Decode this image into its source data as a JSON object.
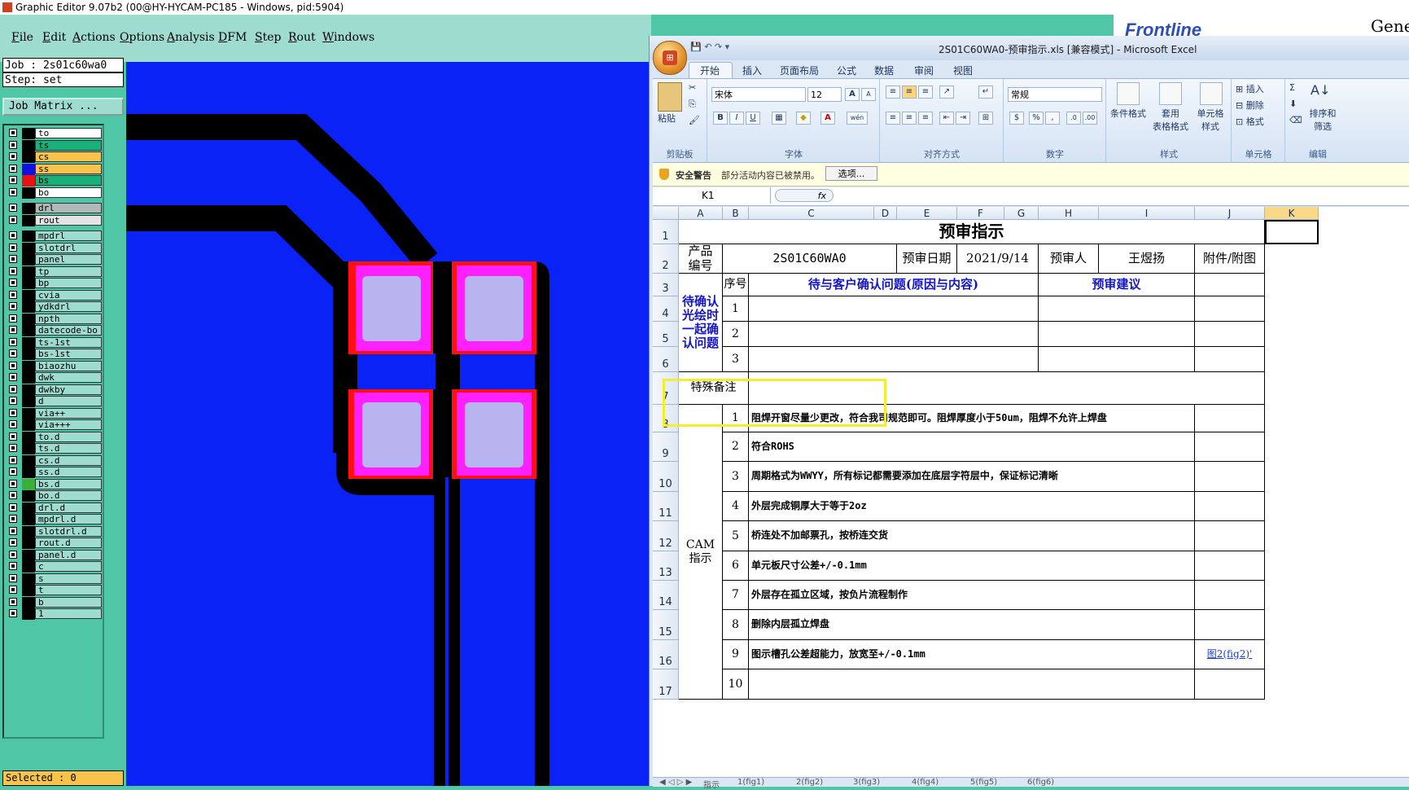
{
  "genesis": {
    "title": "Graphic Editor 9.07b2 (00@HY-HYCAM-PC185 - Windows, pid:5904)",
    "menu": [
      "File",
      "Edit",
      "Actions",
      "Options",
      "Analysis",
      "DFM",
      "Step",
      "Rout",
      "Windows"
    ],
    "job_label": "Job  : 2s01c60wa0",
    "step_label": "Step:  set",
    "job_matrix_button": "Job Matrix ...",
    "selected_label": "Selected : 0",
    "brand_text": "Gene",
    "layers": [
      {
        "name": "to",
        "color": "#ffffff",
        "swatch": "#000000"
      },
      {
        "name": "ts",
        "color": "#1ab07a",
        "swatch": "#000000"
      },
      {
        "name": "cs",
        "color": "#f7c34a",
        "swatch": "#000000"
      },
      {
        "name": "ss",
        "color": "#f7c34a",
        "swatch": "#1010e0"
      },
      {
        "name": "bs",
        "color": "#1ab07a",
        "swatch": "#e81010",
        "mark": "m"
      },
      {
        "name": "bo",
        "color": "#ffffff",
        "swatch": "#000000"
      },
      {
        "name": "drl",
        "color": "#b0b8b8",
        "swatch": "#000000"
      },
      {
        "name": "rout",
        "color": "#e4e4e4",
        "swatch": "#000000"
      },
      {
        "name": "mpdrl",
        "color": "#9fdcd0",
        "swatch": "#000000"
      },
      {
        "name": "slotdrl",
        "color": "#9fdcd0",
        "swatch": "#000000"
      },
      {
        "name": "panel",
        "color": "#9fdcd0",
        "swatch": "#000000"
      },
      {
        "name": "tp",
        "color": "#9fdcd0",
        "swatch": "#000000"
      },
      {
        "name": "bp",
        "color": "#9fdcd0",
        "swatch": "#000000"
      },
      {
        "name": "cvia",
        "color": "#9fdcd0",
        "swatch": "#000000"
      },
      {
        "name": "ydkdrl",
        "color": "#9fdcd0",
        "swatch": "#000000"
      },
      {
        "name": "npth",
        "color": "#9fdcd0",
        "swatch": "#000000"
      },
      {
        "name": "datecode-bo",
        "color": "#9fdcd0",
        "swatch": "#000000"
      },
      {
        "name": "ts-1st",
        "color": "#9fdcd0",
        "swatch": "#000000"
      },
      {
        "name": "bs-1st",
        "color": "#9fdcd0",
        "swatch": "#000000"
      },
      {
        "name": "biaozhu",
        "color": "#9fdcd0",
        "swatch": "#000000"
      },
      {
        "name": "dwk",
        "color": "#9fdcd0",
        "swatch": "#000000"
      },
      {
        "name": "dwkby",
        "color": "#9fdcd0",
        "swatch": "#000000"
      },
      {
        "name": "d",
        "color": "#9fdcd0",
        "swatch": "#000000"
      },
      {
        "name": "via++",
        "color": "#9fdcd0",
        "swatch": "#000000"
      },
      {
        "name": "via+++",
        "color": "#9fdcd0",
        "swatch": "#000000"
      },
      {
        "name": "to.d",
        "color": "#9fdcd0",
        "swatch": "#000000"
      },
      {
        "name": "ts.d",
        "color": "#9fdcd0",
        "swatch": "#000000"
      },
      {
        "name": "cs.d",
        "color": "#9fdcd0",
        "swatch": "#000000",
        "mark": "✍"
      },
      {
        "name": "ss.d",
        "color": "#9fdcd0",
        "swatch": "#000000"
      },
      {
        "name": "bs.d",
        "color": "#9fdcd0",
        "swatch": "#3ab03a"
      },
      {
        "name": "bo.d",
        "color": "#9fdcd0",
        "swatch": "#000000"
      },
      {
        "name": "drl.d",
        "color": "#9fdcd0",
        "swatch": "#000000"
      },
      {
        "name": "mpdrl.d",
        "color": "#9fdcd0",
        "swatch": "#000000"
      },
      {
        "name": "slotdrl.d",
        "color": "#9fdcd0",
        "swatch": "#000000"
      },
      {
        "name": "rout.d",
        "color": "#9fdcd0",
        "swatch": "#000000"
      },
      {
        "name": "panel.d",
        "color": "#9fdcd0",
        "swatch": "#000000"
      },
      {
        "name": "c",
        "color": "#9fdcd0",
        "swatch": "#000000"
      },
      {
        "name": "s",
        "color": "#9fdcd0",
        "swatch": "#000000"
      },
      {
        "name": "t",
        "color": "#9fdcd0",
        "swatch": "#000000"
      },
      {
        "name": "b",
        "color": "#9fdcd0",
        "swatch": "#000000"
      },
      {
        "name": "1",
        "color": "#9fdcd0",
        "swatch": "#000000"
      }
    ],
    "canvas_colors": {
      "background": "#0a22f5",
      "trace": "#000000",
      "pad_outer": "#ff1010",
      "pad_mid": "#ff20ff",
      "pad_inner": "#b8b4f0"
    }
  },
  "excel": {
    "title": "2S01C60WA0-预审指示.xls  [兼容模式] - Microsoft Excel",
    "tabs": [
      "开始",
      "插入",
      "页面布局",
      "公式",
      "数据",
      "审阅",
      "视图"
    ],
    "ribbon": {
      "clipboard": {
        "paste": "粘贴",
        "label": "剪贴板"
      },
      "font": {
        "name": "宋体",
        "size": "12",
        "label": "字体",
        "bold": "B",
        "italic": "I",
        "underline": "U",
        "grow": "A",
        "shrink": "A",
        "color": "A",
        "wen": "wén"
      },
      "align": {
        "label": "对齐方式"
      },
      "number": {
        "format": "常规",
        "label": "数字",
        "percent": "%",
        "comma": ","
      },
      "styles": {
        "cond": "条件格式",
        "table": "套用\n表格格式",
        "cell": "单元格\n样式",
        "label": "样式"
      },
      "cells": {
        "insert": "插入",
        "delete": "删除",
        "format": "格式",
        "label": "单元格"
      },
      "edit": {
        "sort": "排序和\n筛选",
        "label": "编辑"
      }
    },
    "security": {
      "label": "安全警告",
      "message": "部分活动内容已被禁用。",
      "button": "选项..."
    },
    "namebox": "K1",
    "fx": "fx",
    "columns": [
      "A",
      "B",
      "C",
      "D",
      "E",
      "F",
      "G",
      "H",
      "I",
      "J",
      "K"
    ],
    "rows": [
      "1",
      "2",
      "3",
      "4",
      "5",
      "6",
      "7",
      "8",
      "9",
      "10",
      "11",
      "12",
      "13",
      "14",
      "15",
      "16",
      "17"
    ],
    "sheet": {
      "title": "预审指示",
      "product_label": "产品\n编号",
      "product_value": "2S01C60WA0",
      "date_label": "预审日期",
      "date_value": "2021/9/14",
      "reviewer_label": "预审人",
      "reviewer_value": "王煜扬",
      "attach_label": "附件/附图",
      "seq_header": "序号",
      "issue_header": "待与客户确认问题(原因与内容)",
      "suggest_header": "预审建议",
      "confirm_label": "待确认\n光绘时\n一起确\n认问题",
      "confirm_nums": [
        "1",
        "2",
        "3"
      ],
      "special_label": "特殊备注",
      "cam_label": "CAM\n指示",
      "cam_items": [
        {
          "n": "1",
          "text": "阻焊开窗尽量少更改，符合我司规范即可。阻焊厚度小于50um，阻焊不允许上焊盘",
          "link": ""
        },
        {
          "n": "2",
          "text": "符合ROHS",
          "link": ""
        },
        {
          "n": "3",
          "text": "周期格式为WWYY，所有标记都需要添加在底层字符层中，保证标记清晰",
          "link": ""
        },
        {
          "n": "4",
          "text": "外层完成铜厚大于等于2oz",
          "link": ""
        },
        {
          "n": "5",
          "text": "桥连处不加邮票孔，按桥连交货",
          "link": ""
        },
        {
          "n": "6",
          "text": "单元板尺寸公差+/-0.1mm",
          "link": ""
        },
        {
          "n": "7",
          "text": "外层存在孤立区域，按负片流程制作",
          "link": ""
        },
        {
          "n": "8",
          "text": "删除内层孤立焊盘",
          "link": ""
        },
        {
          "n": "9",
          "text": "图示槽孔公差超能力，放宽至+/-0.1mm",
          "link": "图2(fig2)'"
        },
        {
          "n": "10",
          "text": "",
          "link": ""
        }
      ]
    },
    "sheet_tabs": [
      "指示",
      "1(fig1)",
      "2(fig2)",
      "3(fig3)",
      "4(fig4)",
      "5(fig5)",
      "6(fig6)"
    ]
  }
}
